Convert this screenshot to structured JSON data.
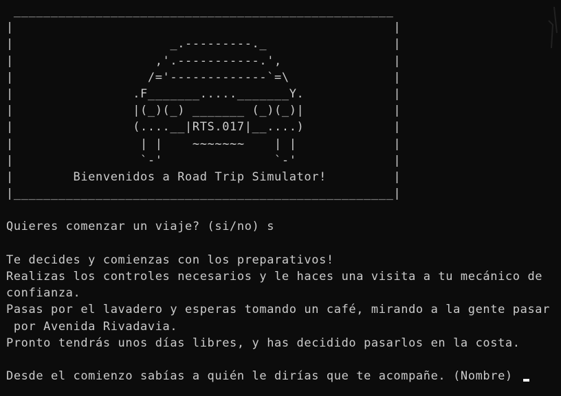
{
  "terminal": {
    "banner": [
      " ___________________________________________________",
      "|                                                   |",
      "|                     _.---------._                 |",
      "|                   ,'.-----------.',               |",
      "|                  /='-------------`=\\              |",
      "|                .F_______....._______Y.            |",
      "|                |(_)(_) _______ (_)(_)|            |",
      "|                (....__|RTS.017|__....)            |",
      "|                 | |    ~~~~~~~    | |             |",
      "|                 `-'               `-'             |",
      "|        Bienvenidos a Road Trip Simulator!         |",
      "|___________________________________________________|"
    ],
    "output": [
      "",
      "Quieres comenzar un viaje? (si/no) s",
      "",
      "Te decides y comienzas con los preparativos!",
      "Realizas los controles necesarios y le haces una visita a tu mecánico de",
      "confianza.",
      "Pasas por el lavadero y esperas tomando un café, mirando a la gente pasar",
      " por Avenida Rivadavia.",
      "Pronto tendrás unos días libres, y has decidido pasarlos en la costa.",
      ""
    ],
    "prompt": "Desde el comienzo sabías a quién le dirías que te acompañe. (Nombre) ",
    "input_value": ""
  },
  "colors": {
    "background": "#0c0c0c",
    "foreground": "#cccccc",
    "cursor": "#f2f2f2"
  }
}
